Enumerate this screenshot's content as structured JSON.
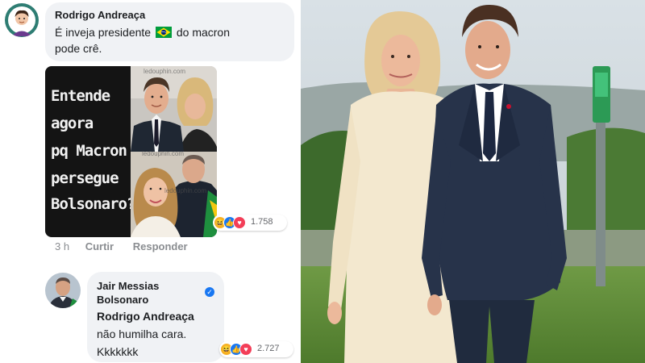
{
  "comment": {
    "author": "Rodrigo Andreaça",
    "text_line1_before": "É inveja presidente",
    "flag_icon": "brazil-flag-icon",
    "text_line1_after": "do macron",
    "text_line2": "pode crê."
  },
  "meme": {
    "lines": [
      "Entende",
      "agora",
      "pq Macron",
      "persegue",
      "Bolsonaro?"
    ],
    "watermarks": [
      "ledouphin.com",
      "ledouphin.com",
      "ledouphin.com"
    ]
  },
  "comment_reactions": {
    "icons": [
      "haha-icon",
      "like-icon",
      "love-icon"
    ],
    "count": "1.758"
  },
  "comment_actions": {
    "time": "3 h",
    "like_label": "Curtir",
    "reply_label": "Responder"
  },
  "reply": {
    "author_line1": "Jair Messias",
    "author_line2": "Bolsonaro",
    "verified_icon": "verified-badge-icon",
    "mention": "Rodrigo Andreaça",
    "text_line1": "não humilha cara.",
    "text_line2": "Kkkkkkk"
  },
  "reply_reactions": {
    "icons": [
      "haha-icon",
      "like-icon",
      "love-icon"
    ],
    "count": "2.727"
  },
  "colors": {
    "bubble": "#f0f2f5",
    "facebook_blue": "#1877f2",
    "love_red": "#f33e58",
    "haha_yellow": "#f7b125",
    "meta_text": "#8a8d91"
  }
}
